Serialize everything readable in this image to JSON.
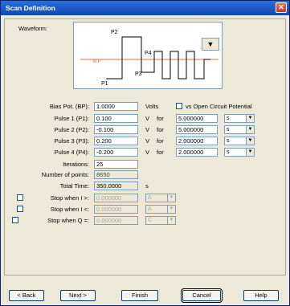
{
  "window": {
    "title": "Scan Definition",
    "close_glyph": "✕"
  },
  "waveform": {
    "label": "Waveform:",
    "p1": "P1",
    "p2": "P2",
    "p3": "P3",
    "p4": "P4",
    "bp": "B.P",
    "dropdown_glyph": "▼"
  },
  "bias": {
    "label": "Bias Pot. (BP):",
    "value": "1.0000",
    "unit": "Volts",
    "vs_label": "vs Open Circuit Potential"
  },
  "pulses": [
    {
      "label": "Pulse 1 (P1):",
      "value": "0.100",
      "unit": "V",
      "for": "for",
      "time": "5.000000",
      "time_unit": "s"
    },
    {
      "label": "Pulse 2 (P2):",
      "value": "-0.100",
      "unit": "V",
      "for": "for",
      "time": "5.000000",
      "time_unit": "s"
    },
    {
      "label": "Pulse 3 (P3):",
      "value": "0.200",
      "unit": "V",
      "for": "for",
      "time": "2.000000",
      "time_unit": "s"
    },
    {
      "label": "Pulse 4 (P4):",
      "value": "-0.200",
      "unit": "V",
      "for": "for",
      "time": "2.000000",
      "time_unit": "s"
    }
  ],
  "iterations": {
    "label": "Iterations:",
    "value": "25"
  },
  "points": {
    "label": "Number of points:",
    "value": "8650"
  },
  "total_time": {
    "label": "Total Time:",
    "value": "350.0000",
    "unit": "s"
  },
  "stops": [
    {
      "label": "Stop when I >:",
      "value": "0.000000",
      "unit": "A"
    },
    {
      "label": "Stop when I <:",
      "value": "0.000000",
      "unit": "A"
    },
    {
      "label": "Stop when Q =:",
      "value": "0.000000",
      "unit": "C"
    }
  ],
  "buttons": {
    "back": "< Back",
    "next": "Next >",
    "finish": "Finish",
    "cancel": "Cancel",
    "help": "Help"
  },
  "colors": {
    "title_bar": "#1e5cc9",
    "bp_line": "#e07040"
  }
}
